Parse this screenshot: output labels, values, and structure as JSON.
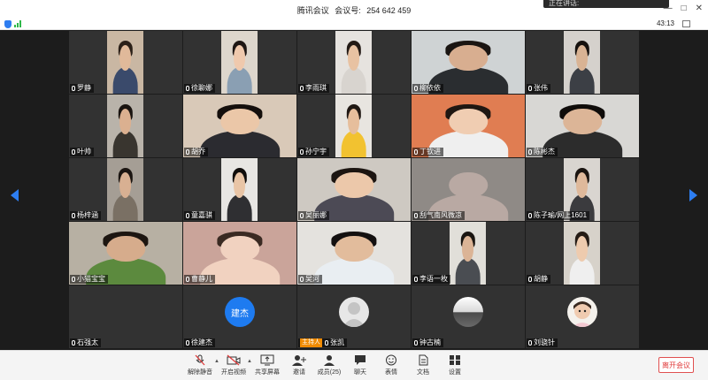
{
  "window": {
    "meeting_name": "腾讯会议",
    "meeting_id_label": "会议号:",
    "meeting_id": "254 642 459",
    "popup_text": "正在讲话:",
    "minimize": "—",
    "maximize": "□",
    "close": "✕"
  },
  "status": {
    "clock": "43:13"
  },
  "participants": [
    {
      "name": "罗静",
      "muted": true
    },
    {
      "name": "徐聊娜",
      "muted": true
    },
    {
      "name": "李雨琪",
      "muted": true
    },
    {
      "name": "柳依依",
      "muted": true
    },
    {
      "name": "张伟",
      "muted": true
    },
    {
      "name": "叶帅",
      "muted": true
    },
    {
      "name": "胡乔",
      "muted": true
    },
    {
      "name": "孙宁宇",
      "muted": true
    },
    {
      "name": "丁钦进",
      "muted": true
    },
    {
      "name": "陈彬杰",
      "muted": true
    },
    {
      "name": "杨梓涵",
      "muted": true
    },
    {
      "name": "童嘉骐",
      "muted": true
    },
    {
      "name": "吴丽娜",
      "muted": true
    },
    {
      "name": "刮气南风微凉",
      "muted": true
    },
    {
      "name": "陈子瑜/网上1601",
      "muted": true
    },
    {
      "name": "小猫宝宝",
      "muted": true
    },
    {
      "name": "曹静儿",
      "muted": true
    },
    {
      "name": "吴河",
      "muted": true
    },
    {
      "name": "李语一枚",
      "muted": true
    },
    {
      "name": "胡静",
      "muted": true
    },
    {
      "name": "石强太",
      "muted": true,
      "avatar": "none"
    },
    {
      "name": "徐建杰",
      "muted": true,
      "avatar": "建杰",
      "avatar_color": "#1e7bf0"
    },
    {
      "name": "张凯",
      "muted": true,
      "host": true,
      "host_label": "主持人",
      "avatar": "default"
    },
    {
      "name": "钟古楠",
      "muted": true,
      "avatar": "photo"
    },
    {
      "name": "刘骁针",
      "muted": true,
      "avatar": "child"
    }
  ],
  "toolbar": {
    "unmute": "解除静音",
    "start_video": "开启视频",
    "share_screen": "共享屏幕",
    "invite": "邀请",
    "members": "成员(25)",
    "chat": "聊天",
    "reaction": "表情",
    "docs": "文档",
    "settings": "设置",
    "leave": "离开会议"
  },
  "colors": {
    "accent": "#2d7ef2",
    "leave": "#e03b3b",
    "host": "#f08a00"
  }
}
